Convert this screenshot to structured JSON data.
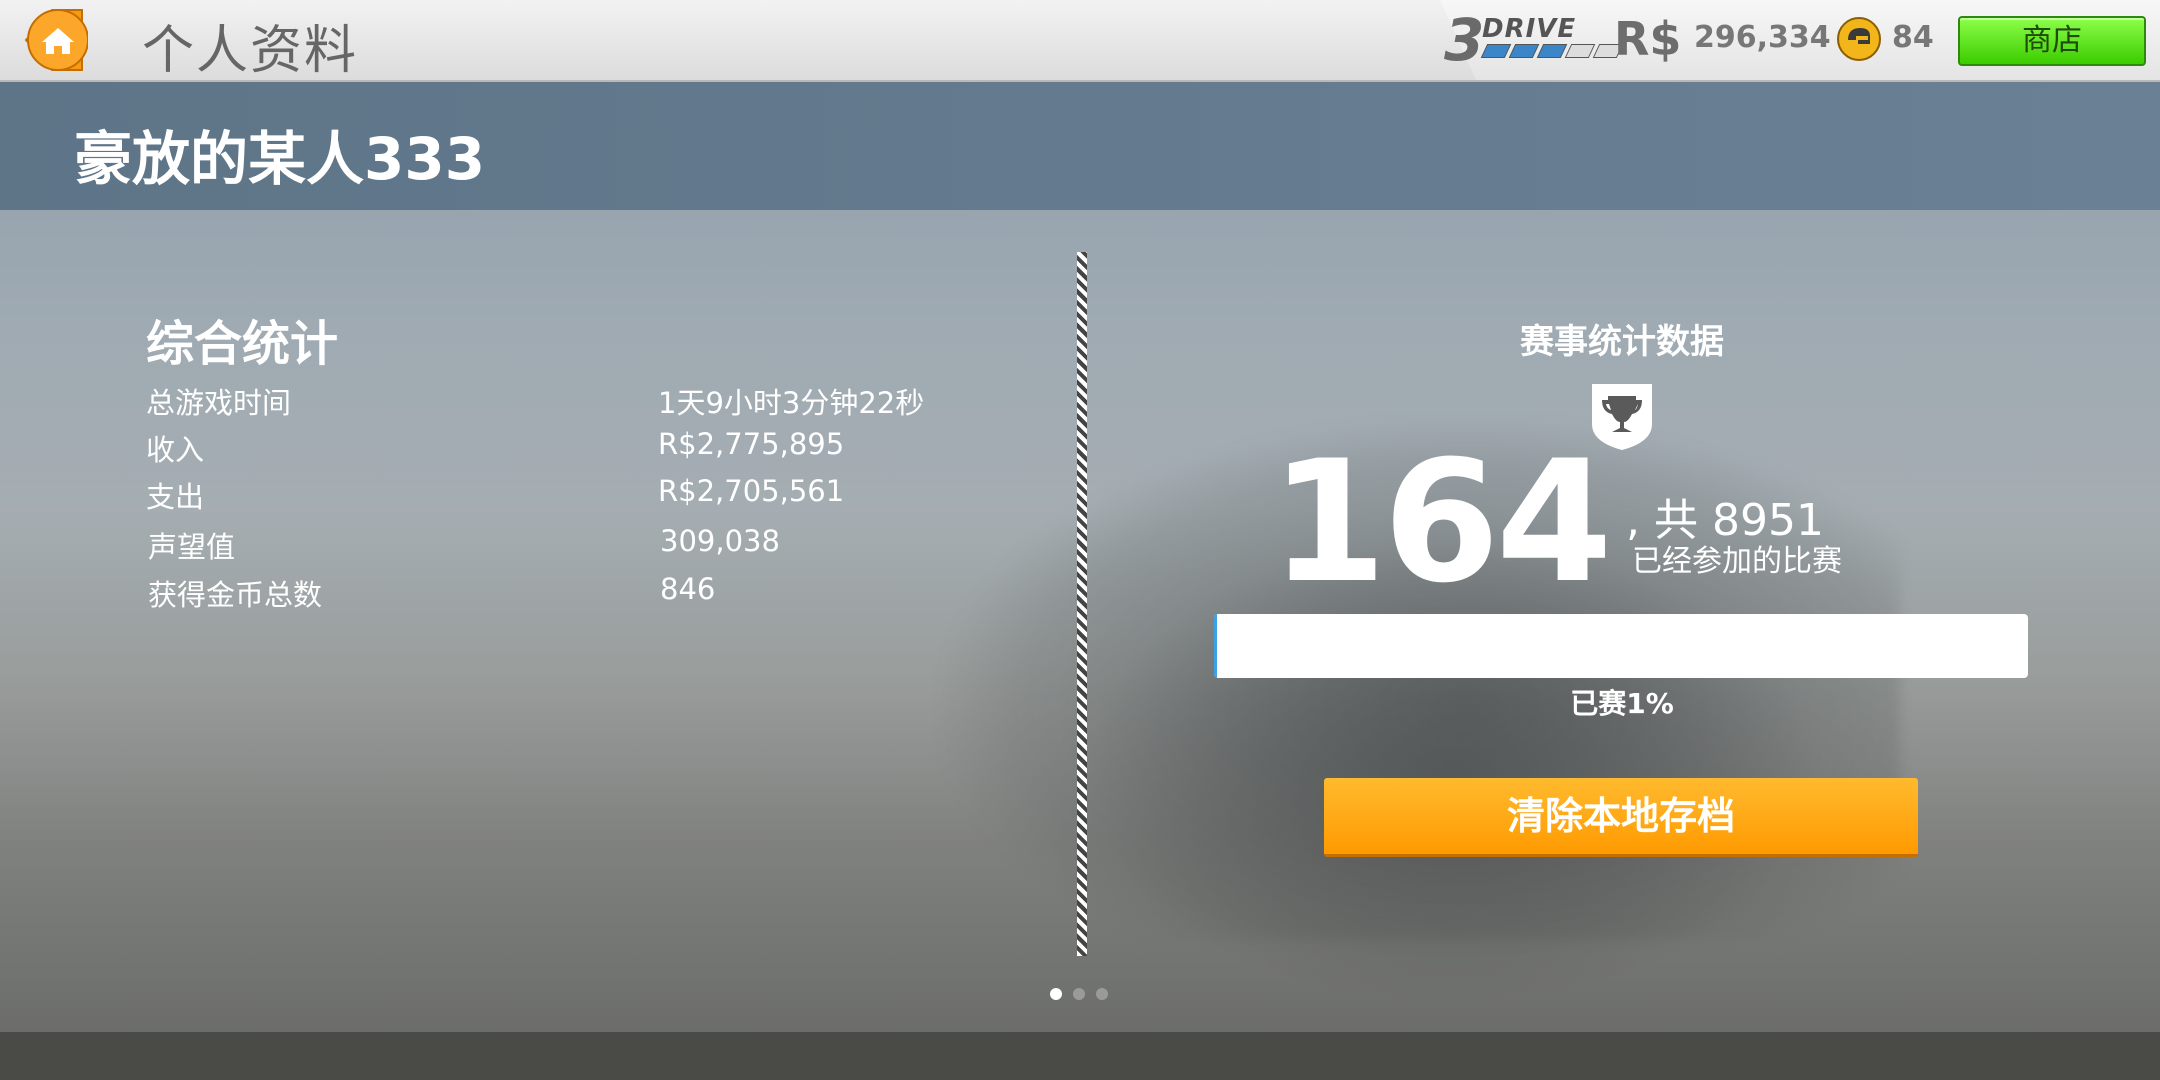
{
  "header": {
    "page_title": "个人资料",
    "logo_number": "3",
    "logo_text": "DRIVE",
    "currency_label": "R$",
    "currency_value": "296,334",
    "gold_value": "84",
    "shop_label": "商店"
  },
  "player": {
    "name": "豪放的某人333"
  },
  "overall_stats": {
    "title": "综合统计",
    "rows": [
      {
        "label": "总游戏时间",
        "value": "1天9小时3分钟22秒"
      },
      {
        "label": "收入",
        "value": "R$2,775,895"
      },
      {
        "label": "支出",
        "value": "R$2,705,561"
      },
      {
        "label": "声望值",
        "value": "309,038"
      },
      {
        "label": "获得金币总数",
        "value": "846"
      }
    ]
  },
  "race_stats": {
    "title": "赛事统计数据",
    "count": "164",
    "total_text": ", 共 8951",
    "sub_text": "已经参加的比赛",
    "progress_percent": 1,
    "progress_label": "已赛1%"
  },
  "actions": {
    "clear_label": "清除本地存档"
  },
  "pager": {
    "pages": 3,
    "active": 0
  },
  "colors": {
    "shop_green": "#4bdc00",
    "clear_orange": "#ffa414",
    "progress_blue": "#3aa0e8"
  }
}
